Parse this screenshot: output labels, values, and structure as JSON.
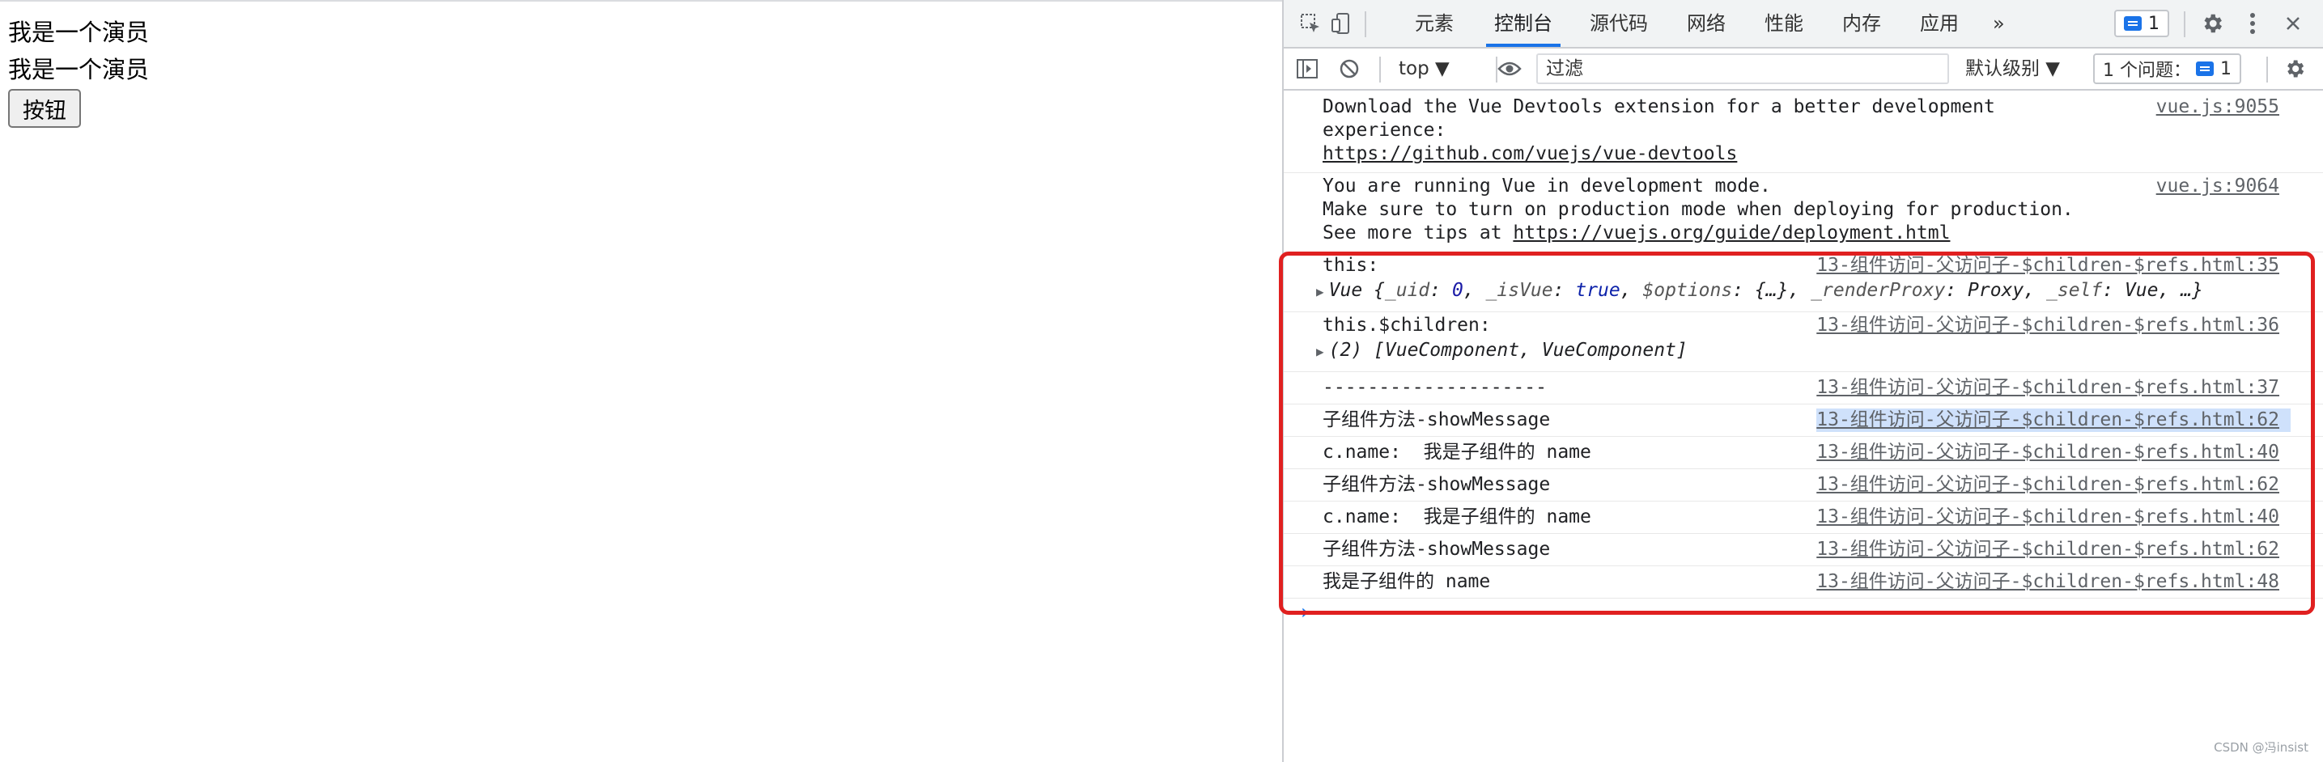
{
  "page": {
    "lines": [
      "我是一个演员",
      "我是一个演员"
    ],
    "button_label": "按钮"
  },
  "devtools": {
    "tabs": [
      "元素",
      "控制台",
      "源代码",
      "网络",
      "性能",
      "内存",
      "应用"
    ],
    "active_tab": "控制台",
    "more_tabs": "»",
    "message_count": "1",
    "context": "top ▼",
    "filter_placeholder": "过滤",
    "levels": "默认级别 ▼",
    "issues_label": "1 个问题：",
    "issues_count": "1",
    "accent_color": "#1a73e8"
  },
  "console": {
    "m1": {
      "line1": "Download the Vue Devtools extension for a better development",
      "line2": "experience:",
      "link": "https://github.com/vuejs/vue-devtools",
      "src": "vue.js:9055"
    },
    "m2": {
      "line1": "You are running Vue in development mode.",
      "line2": "Make sure to turn on production mode when deploying for production.",
      "line3_prefix": "See more tips at ",
      "link": "https://vuejs.org/guide/deployment.html",
      "src": "vue.js:9064"
    },
    "m3": {
      "label": "this:",
      "obj_prefix": "Vue {",
      "k1": "_uid",
      "v1": "0",
      "k2": "_isVue",
      "v2": "true",
      "k3": "$options",
      "v3": "{…}",
      "k4": "_renderProxy",
      "v4": "Proxy",
      "k5": "_self",
      "v5": "Vue",
      "obj_suffix": "…}",
      "src": "13-组件访问-父访问子-$children-$refs.html:35"
    },
    "m4": {
      "label": "this.$children:",
      "obj": "(2) [VueComponent, VueComponent]",
      "src": "13-组件访问-父访问子-$children-$refs.html:36"
    },
    "simple": [
      {
        "text": "--------------------",
        "src": "13-组件访问-父访问子-$children-$refs.html:37"
      },
      {
        "text": "子组件方法-showMessage",
        "src": "13-组件访问-父访问子-$children-$refs.html:62"
      },
      {
        "text": "c.name:  我是子组件的 name",
        "src": "13-组件访问-父访问子-$children-$refs.html:40"
      },
      {
        "text": "子组件方法-showMessage",
        "src": "13-组件访问-父访问子-$children-$refs.html:62"
      },
      {
        "text": "c.name:  我是子组件的 name",
        "src": "13-组件访问-父访问子-$children-$refs.html:40"
      },
      {
        "text": "子组件方法-showMessage",
        "src": "13-组件访问-父访问子-$children-$refs.html:62"
      },
      {
        "text": "我是子组件的 name",
        "src": "13-组件访问-父访问子-$children-$refs.html:48"
      }
    ],
    "prompt": "›"
  },
  "watermark": "CSDN @冯insist"
}
